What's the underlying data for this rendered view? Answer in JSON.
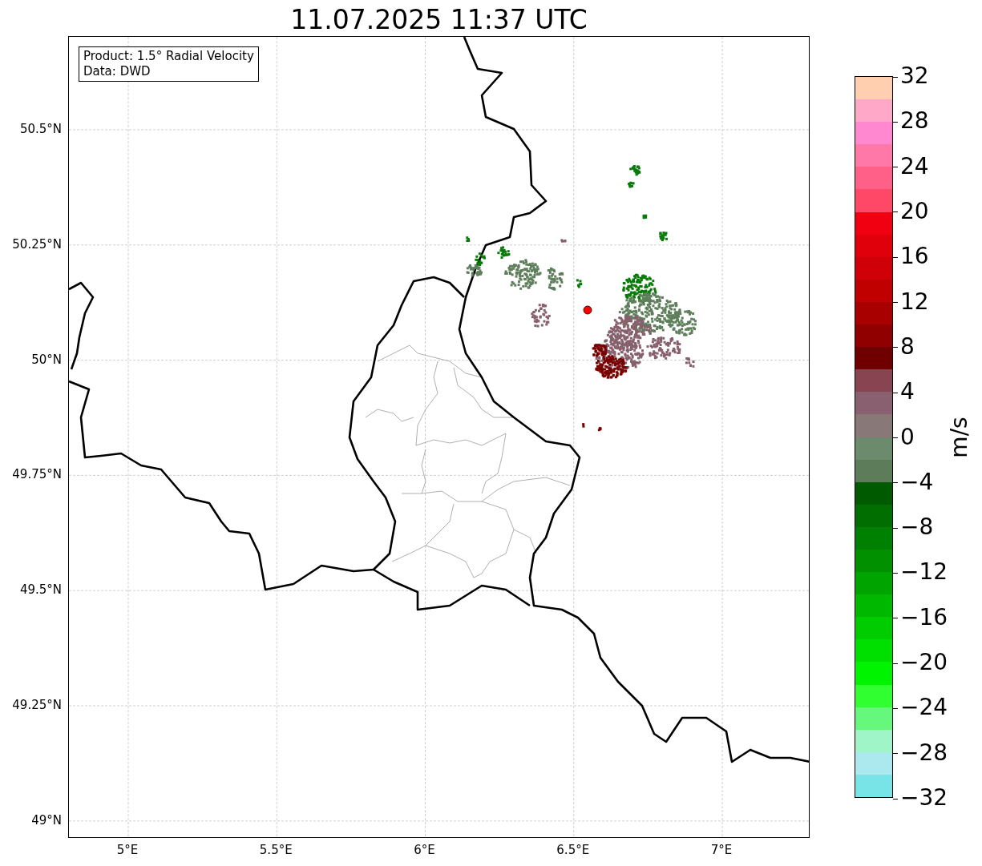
{
  "title": "11.07.2025 11:37 UTC",
  "map": {
    "info_box": [
      "Product: 1.5° Radial Velocity",
      "Data: DWD"
    ],
    "lat_ticks": [
      "50.5°N",
      "50.25°N",
      "50°N",
      "49.75°N",
      "49.5°N",
      "49.25°N",
      "49°N"
    ],
    "lon_ticks": [
      "5°E",
      "5.5°E",
      "6°E",
      "6.5°E",
      "7°E"
    ]
  },
  "colorbar": {
    "label": "m/s",
    "ticks": [
      "32",
      "28",
      "24",
      "20",
      "16",
      "12",
      "8",
      "4",
      "0",
      "−4",
      "−8",
      "−12",
      "−16",
      "−20",
      "−24",
      "−28",
      "−32"
    ],
    "bands": [
      {
        "color": "#ffcfb0"
      },
      {
        "color": "#ffa8c8"
      },
      {
        "color": "#ff88d0"
      },
      {
        "color": "#ff78a8"
      },
      {
        "color": "#ff6088"
      },
      {
        "color": "#ff4868"
      },
      {
        "color": "#f00010"
      },
      {
        "color": "#e0000c"
      },
      {
        "color": "#d00008"
      },
      {
        "color": "#c00000"
      },
      {
        "color": "#a80000"
      },
      {
        "color": "#900000"
      },
      {
        "color": "#700000"
      },
      {
        "color": "#884450"
      },
      {
        "color": "#886070"
      },
      {
        "color": "#887878"
      },
      {
        "color": "#6c8a6c"
      },
      {
        "color": "#5c7c5a"
      },
      {
        "color": "#005a00"
      },
      {
        "color": "#006e00"
      },
      {
        "color": "#008000"
      },
      {
        "color": "#009000"
      },
      {
        "color": "#00a400"
      },
      {
        "color": "#00b800"
      },
      {
        "color": "#00cc00"
      },
      {
        "color": "#00e000"
      },
      {
        "color": "#00f400"
      },
      {
        "color": "#30ff30"
      },
      {
        "color": "#66f87c"
      },
      {
        "color": "#9ff5c8"
      },
      {
        "color": "#abe9ef"
      },
      {
        "color": "#78e4e8"
      }
    ]
  }
}
